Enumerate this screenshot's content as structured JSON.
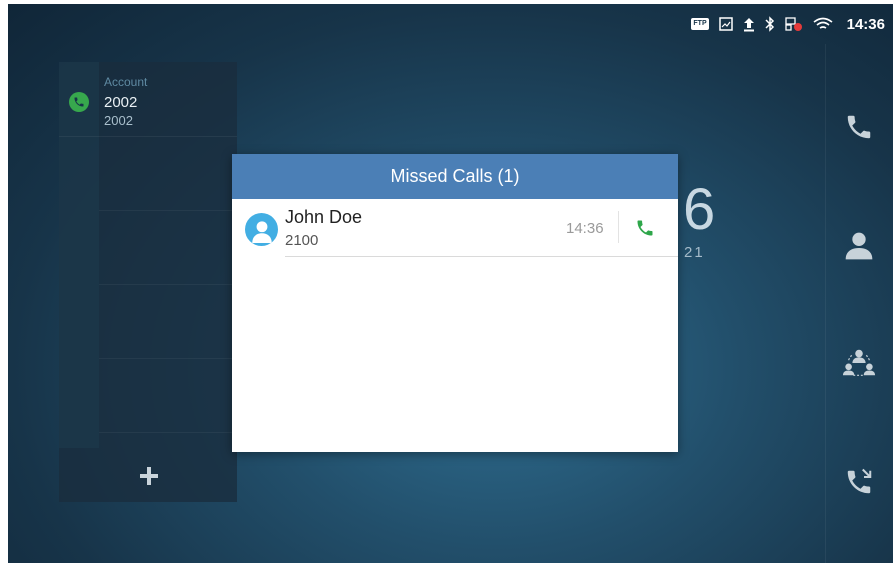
{
  "status_bar": {
    "ftp_label": "FTP",
    "time": "14:36",
    "icons": [
      "ftp-icon",
      "image-icon",
      "upload-icon",
      "bluetooth-icon",
      "network-icon",
      "wifi-icon"
    ]
  },
  "account_panel": {
    "caption": "Account",
    "name": "2002",
    "number": "2002",
    "add_icon": "plus-icon"
  },
  "background": {
    "time_digit": "6",
    "date_digits": "21"
  },
  "right_dock": {
    "items": [
      "phone-icon",
      "contacts-icon",
      "conference-icon",
      "call-history-icon"
    ]
  },
  "dialog": {
    "title": "Missed Calls (1)",
    "calls": [
      {
        "name": "John Doe",
        "number": "2100",
        "time": "14:36"
      }
    ]
  },
  "colors": {
    "dialog_header": "#4b7fb6",
    "accent_green": "#37a84d",
    "avatar_blue": "#42aee3"
  }
}
